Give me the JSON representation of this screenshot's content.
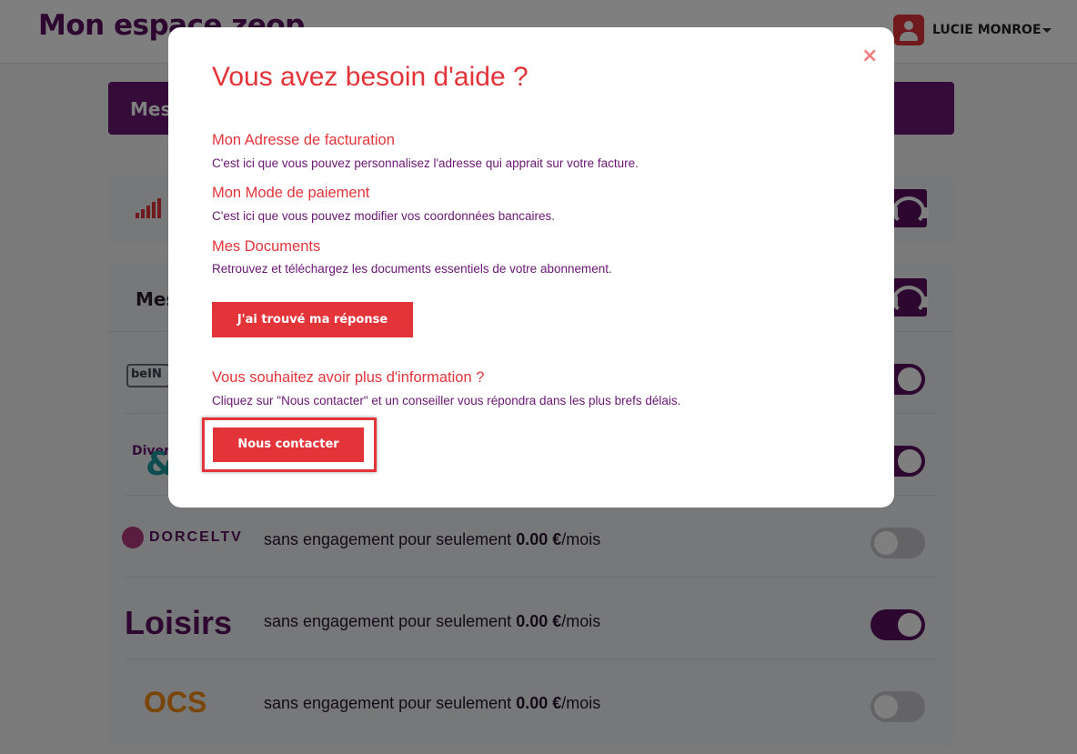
{
  "header": {
    "site_title": "Mon espace zeop",
    "user_name": "LUCIE MONROE"
  },
  "banner": {
    "label": "Mes"
  },
  "section": {
    "title": "Mes"
  },
  "options": [
    {
      "logo": "beIN",
      "text_prefix": "",
      "price": "",
      "suffix": "",
      "enabled": true
    },
    {
      "logo": "Divert",
      "text_prefix": "",
      "price": "",
      "suffix": "",
      "enabled": true
    },
    {
      "logo": "DORCELTV",
      "text_prefix": "sans engagement pour seulement",
      "price": "0.00 €",
      "suffix": "/mois",
      "enabled": false
    },
    {
      "logo": "Loisirs",
      "text_prefix": "sans engagement pour seulement",
      "price": "0.00 €",
      "suffix": "/mois",
      "enabled": true
    },
    {
      "logo": "OCS",
      "text_prefix": "sans engagement pour seulement",
      "price": "0.00 €",
      "suffix": "/mois",
      "enabled": false
    }
  ],
  "modal": {
    "title": "Vous avez besoin d'aide ?",
    "close": "×",
    "items": [
      {
        "title": "Mon Adresse de facturation",
        "desc": "C'est ici que vous pouvez personnalisez l'adresse qui apprait sur votre facture."
      },
      {
        "title": "Mon Mode de paiement",
        "desc": "C'est ici que vous pouvez modifier vos coordonnées bancaires."
      },
      {
        "title": "Mes Documents",
        "desc": "Retrouvez et téléchargez les documents essentiels de votre abonnement."
      }
    ],
    "found_button": "J'ai trouvé ma réponse",
    "more_title": "Vous souhaitez avoir plus d'information ?",
    "more_desc": "Cliquez sur \"Nous contacter\" et un conseiller vous répondra dans les plus brefs délais.",
    "contact_button": "Nous contacter"
  },
  "colors": {
    "brand_purple": "#5a0f5e",
    "accent_red": "#e3343a"
  }
}
